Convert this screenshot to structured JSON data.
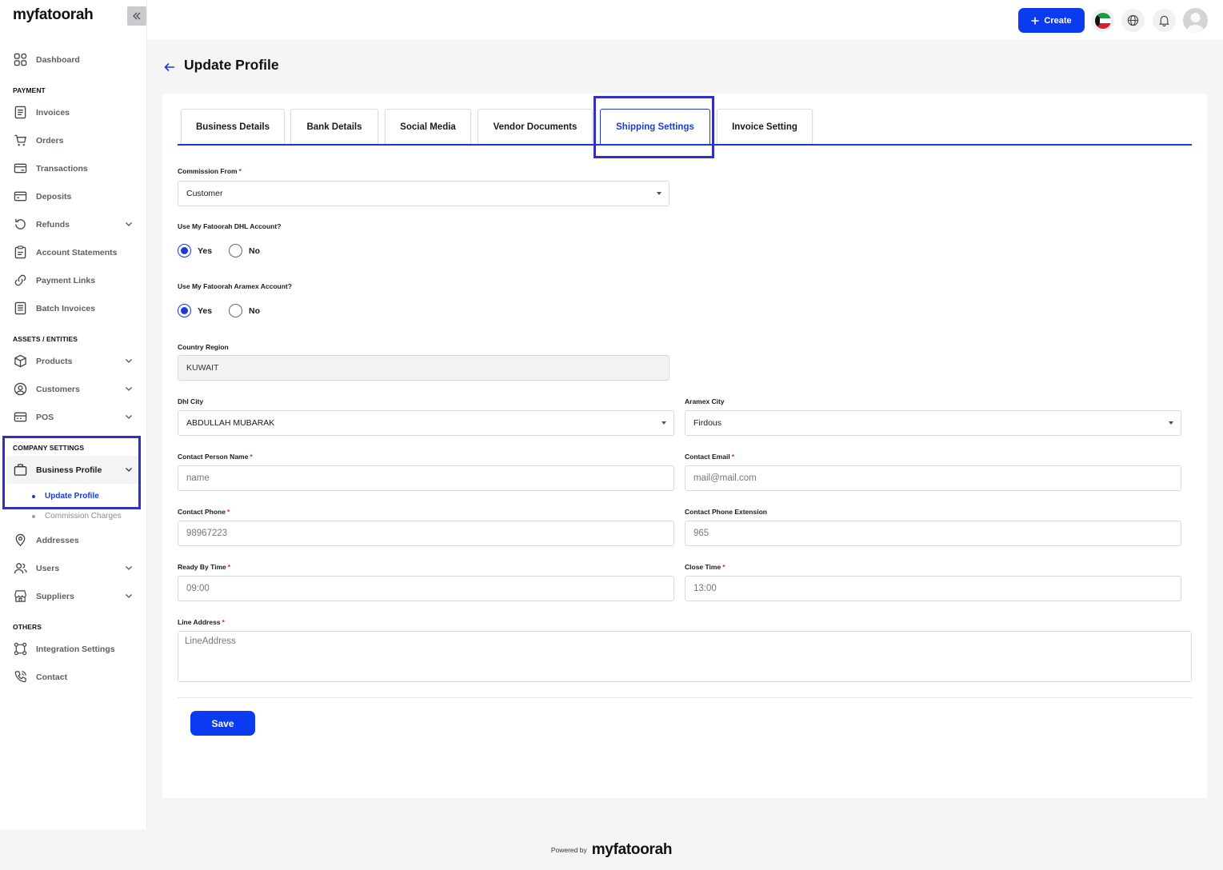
{
  "brand": {
    "logo_text": "myfatoorah"
  },
  "sidebar": {
    "dashboard": "Dashboard",
    "sections": {
      "payment": "PAYMENT",
      "assets": "ASSETS / ENTITIES",
      "company": "COMPANY SETTINGS",
      "others": "OTHERS"
    },
    "payment_items": [
      "Invoices",
      "Orders",
      "Transactions",
      "Deposits",
      "Refunds",
      "Account Statements",
      "Payment Links",
      "Batch Invoices"
    ],
    "asset_items": [
      "Products",
      "Customers",
      "POS"
    ],
    "business_profile": "Business Profile",
    "sub_items": [
      "Update Profile",
      "Commission Charges"
    ],
    "company_items": [
      "Addresses",
      "Users",
      "Suppliers"
    ],
    "other_items": [
      "Integration Settings",
      "Contact"
    ]
  },
  "topbar": {
    "create_label": "Create"
  },
  "page": {
    "title": "Update Profile"
  },
  "tabs": [
    "Business Details",
    "Bank Details",
    "Social Media",
    "Vendor Documents",
    "Shipping Settings",
    "Invoice Setting"
  ],
  "form": {
    "commission_from": {
      "label": "Commission From",
      "value": "Customer"
    },
    "dhl_account": {
      "label": "Use My Fatoorah DHL Account?",
      "yes": "Yes",
      "no": "No",
      "selected": "Yes"
    },
    "aramex_account": {
      "label": "Use My Fatoorah Aramex Account?",
      "yes": "Yes",
      "no": "No",
      "selected": "Yes"
    },
    "country_region": {
      "label": "Country Region",
      "value": "KUWAIT"
    },
    "dhl_city": {
      "label": "Dhl City",
      "value": "ABDULLAH MUBARAK"
    },
    "aramex_city": {
      "label": "Aramex City",
      "value": "Firdous"
    },
    "contact_name": {
      "label": "Contact Person Name",
      "placeholder": "name"
    },
    "contact_email": {
      "label": "Contact Email",
      "placeholder": "mail@mail.com"
    },
    "contact_phone": {
      "label": "Contact Phone",
      "placeholder": "98967223"
    },
    "phone_ext": {
      "label": "Contact Phone Extension",
      "placeholder": "965"
    },
    "ready_time": {
      "label": "Ready By Time",
      "placeholder": "09:00"
    },
    "close_time": {
      "label": "Close Time",
      "placeholder": "13:00"
    },
    "line_address": {
      "label": "Line Address",
      "placeholder": "LineAddress"
    },
    "required_mark": "*",
    "save_label": "Save"
  },
  "footer": {
    "powered_by": "Powered by",
    "logo_text": "myfatoorah"
  },
  "colors": {
    "accent": "#0b3bf0",
    "highlight": "#3030c4",
    "required": "#e0202a"
  }
}
